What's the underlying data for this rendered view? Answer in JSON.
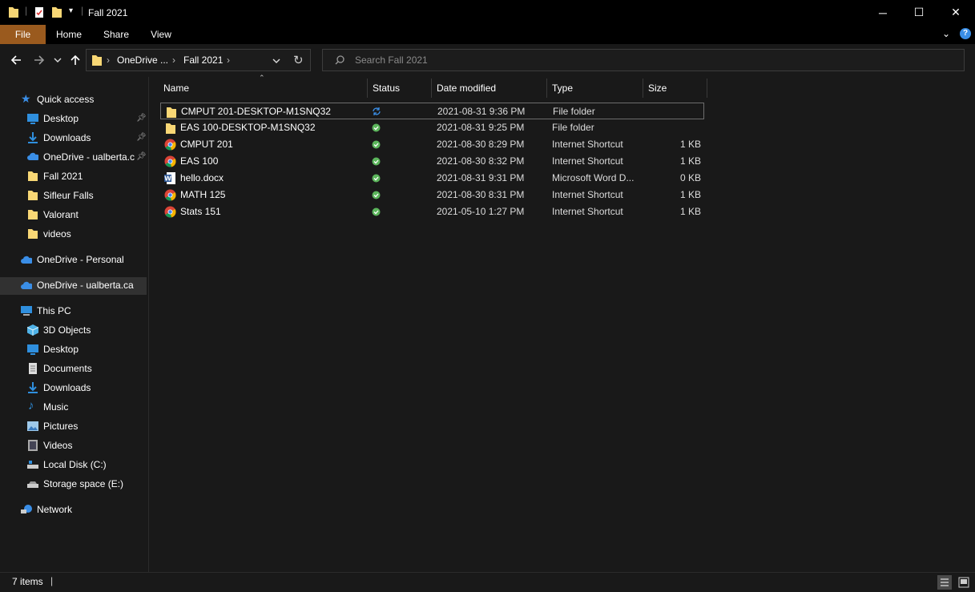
{
  "window": {
    "title": "Fall 2021",
    "controls": {
      "minimize": "─",
      "maximize": "☐",
      "close": "✕"
    }
  },
  "ribbon": {
    "tabs": [
      "File",
      "Home",
      "Share",
      "View"
    ],
    "accent": "#9a5a1e"
  },
  "nav": {
    "breadcrumb": [
      "OneDrive ...",
      "Fall 2021"
    ],
    "search_placeholder": "Search Fall 2021"
  },
  "sidebar": {
    "quick_access": {
      "label": "Quick access",
      "items": [
        {
          "label": "Desktop",
          "icon": "desktop-icon",
          "pinned": true
        },
        {
          "label": "Downloads",
          "icon": "downloads-icon",
          "pinned": true
        },
        {
          "label": "OneDrive - ualberta.c",
          "icon": "cloud-icon",
          "pinned": true
        },
        {
          "label": "Fall 2021",
          "icon": "folder-icon",
          "pinned": false
        },
        {
          "label": "Sifleur Falls",
          "icon": "folder-icon",
          "pinned": false
        },
        {
          "label": "Valorant",
          "icon": "folder-icon",
          "pinned": false
        },
        {
          "label": "videos",
          "icon": "folder-icon",
          "pinned": false
        }
      ]
    },
    "onedrive_personal": "OneDrive - Personal",
    "onedrive_ualberta": "OneDrive - ualberta.ca",
    "this_pc": {
      "label": "This PC",
      "items": [
        {
          "label": "3D Objects",
          "icon": "3d-objects-icon"
        },
        {
          "label": "Desktop",
          "icon": "desktop-icon"
        },
        {
          "label": "Documents",
          "icon": "documents-icon"
        },
        {
          "label": "Downloads",
          "icon": "downloads-icon"
        },
        {
          "label": "Music",
          "icon": "music-icon"
        },
        {
          "label": "Pictures",
          "icon": "pictures-icon"
        },
        {
          "label": "Videos",
          "icon": "videos-icon"
        },
        {
          "label": "Local Disk (C:)",
          "icon": "drive-icon"
        },
        {
          "label": "Storage space (E:)",
          "icon": "drive-icon"
        }
      ]
    },
    "network": "Network"
  },
  "columns": [
    "Name",
    "Status",
    "Date modified",
    "Type",
    "Size"
  ],
  "files": [
    {
      "name": "CMPUT 201-DESKTOP-M1SNQ32",
      "status": "syncing",
      "date": "2021-08-31 9:36 PM",
      "type": "File folder",
      "size": "",
      "icon": "folder-icon"
    },
    {
      "name": "EAS 100-DESKTOP-M1SNQ32",
      "status": "synced",
      "date": "2021-08-31 9:25 PM",
      "type": "File folder",
      "size": "",
      "icon": "folder-icon"
    },
    {
      "name": "CMPUT 201",
      "status": "synced",
      "date": "2021-08-30 8:29 PM",
      "type": "Internet Shortcut",
      "size": "1 KB",
      "icon": "chrome-shortcut-icon"
    },
    {
      "name": "EAS 100",
      "status": "synced",
      "date": "2021-08-30 8:32 PM",
      "type": "Internet Shortcut",
      "size": "1 KB",
      "icon": "chrome-shortcut-icon"
    },
    {
      "name": "hello.docx",
      "status": "synced",
      "date": "2021-08-31 9:31 PM",
      "type": "Microsoft Word D...",
      "size": "0 KB",
      "icon": "word-doc-icon"
    },
    {
      "name": "MATH 125",
      "status": "synced",
      "date": "2021-08-30 8:31 PM",
      "type": "Internet Shortcut",
      "size": "1 KB",
      "icon": "chrome-shortcut-icon"
    },
    {
      "name": "Stats 151",
      "status": "synced",
      "date": "2021-05-10 1:27 PM",
      "type": "Internet Shortcut",
      "size": "1 KB",
      "icon": "chrome-shortcut-icon"
    }
  ],
  "status_bar": {
    "item_count": "7 items"
  },
  "colors": {
    "folder": "#f8d775",
    "synced": "#5bb55b",
    "syncing": "#3a8ee6",
    "onedrive": "#3a8ee6"
  }
}
